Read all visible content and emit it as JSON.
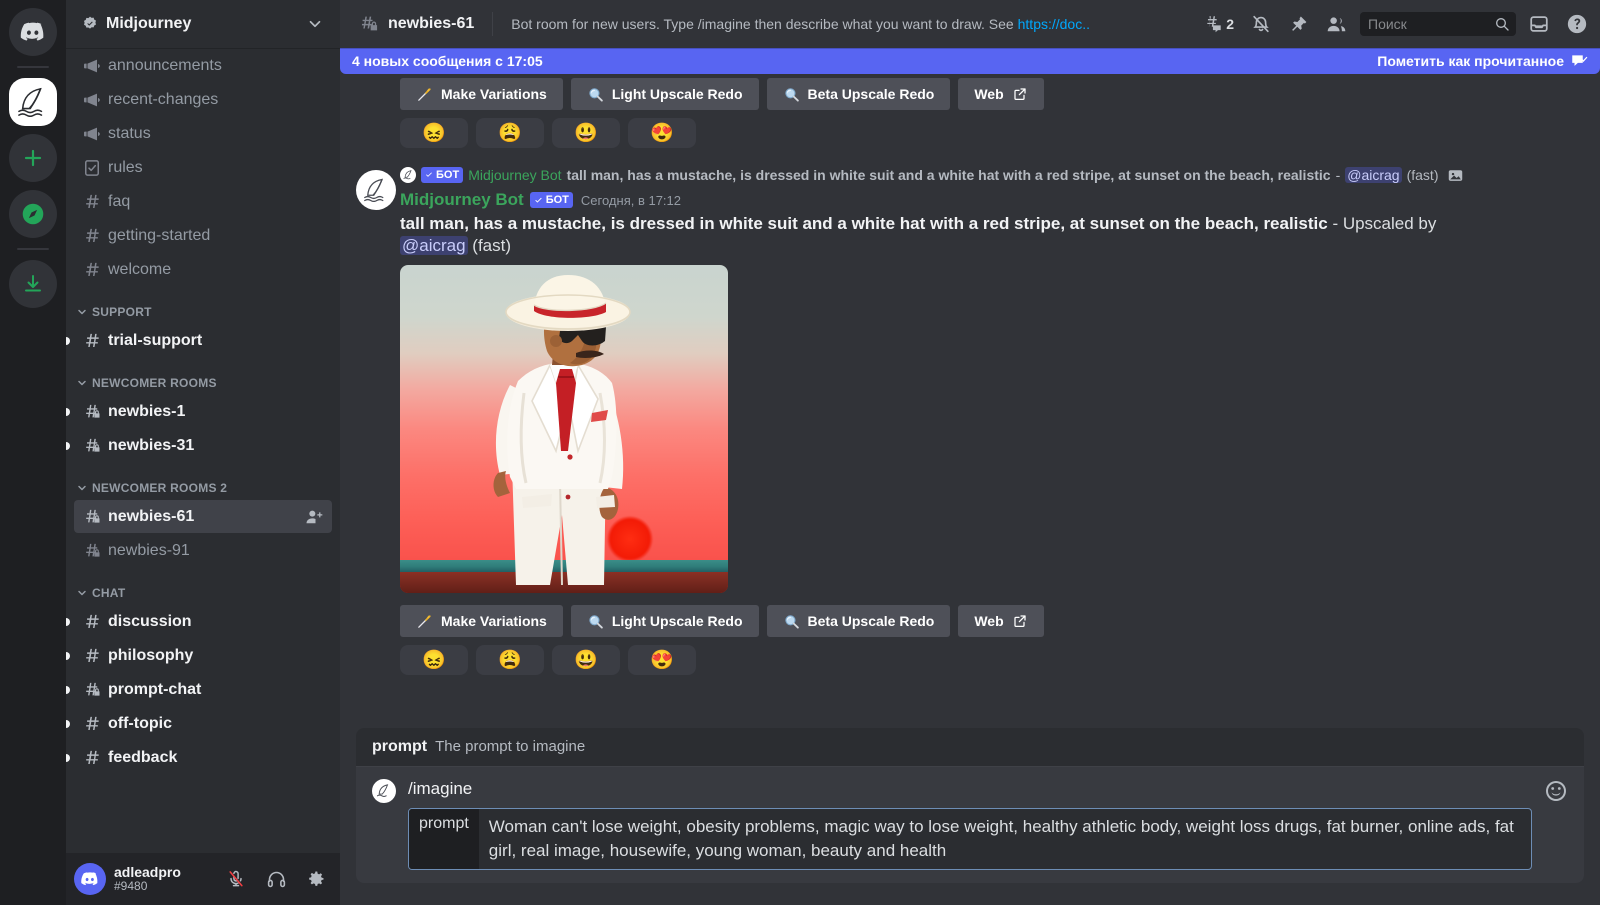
{
  "rail": {
    "items": [
      {
        "name": "discord-home",
        "icon": "discord-logo",
        "active": false
      },
      {
        "name": "server-midjourney",
        "icon": "midjourney-sail",
        "active": true
      },
      {
        "name": "add-server",
        "icon": "plus-icon",
        "active": false
      },
      {
        "name": "explore-servers",
        "icon": "compass-icon",
        "active": false
      },
      {
        "name": "download-apps",
        "icon": "download-icon",
        "active": false
      }
    ]
  },
  "sidebar": {
    "guild_name": "Midjourney",
    "groups": [
      {
        "label": "",
        "channels": [
          {
            "name": "announcements",
            "icon": "announcement-icon",
            "state": "muted",
            "unread": false
          },
          {
            "name": "recent-changes",
            "icon": "announcement-icon",
            "state": "muted",
            "unread": false
          },
          {
            "name": "status",
            "icon": "announcement-icon",
            "state": "muted",
            "unread": false
          },
          {
            "name": "rules",
            "icon": "rules-icon",
            "state": "muted",
            "unread": false
          },
          {
            "name": "faq",
            "icon": "hash-icon",
            "state": "muted",
            "unread": false
          },
          {
            "name": "getting-started",
            "icon": "hash-icon",
            "state": "muted",
            "unread": false
          },
          {
            "name": "welcome",
            "icon": "hash-icon",
            "state": "muted",
            "unread": false
          }
        ]
      },
      {
        "label": "SUPPORT",
        "channels": [
          {
            "name": "trial-support",
            "icon": "hash-icon",
            "state": "unread",
            "unread": true
          }
        ]
      },
      {
        "label": "NEWCOMER ROOMS",
        "channels": [
          {
            "name": "newbies-1",
            "icon": "hash-locked-icon",
            "state": "unread",
            "unread": true
          },
          {
            "name": "newbies-31",
            "icon": "hash-locked-icon",
            "state": "unread",
            "unread": true
          }
        ]
      },
      {
        "label": "NEWCOMER ROOMS 2",
        "channels": [
          {
            "name": "newbies-61",
            "icon": "hash-locked-icon",
            "state": "selected",
            "unread": false,
            "action_icon": "add-member-icon"
          },
          {
            "name": "newbies-91",
            "icon": "hash-locked-icon",
            "state": "muted",
            "unread": false
          }
        ]
      },
      {
        "label": "CHAT",
        "channels": [
          {
            "name": "discussion",
            "icon": "hash-icon",
            "state": "unread",
            "unread": true
          },
          {
            "name": "philosophy",
            "icon": "hash-icon",
            "state": "unread",
            "unread": true
          },
          {
            "name": "prompt-chat",
            "icon": "hash-locked-icon",
            "state": "unread",
            "unread": true
          },
          {
            "name": "off-topic",
            "icon": "hash-icon",
            "state": "unread",
            "unread": true
          },
          {
            "name": "feedback",
            "icon": "hash-icon",
            "state": "unread",
            "unread": true
          }
        ]
      }
    ],
    "user": {
      "name": "adleadpro",
      "tag": "#9480",
      "buttons": [
        "mute-icon",
        "deafen-icon",
        "settings-icon"
      ]
    }
  },
  "topbar": {
    "channel_name": "newbies-61",
    "topic_text": "Bot room for new users. Type /imagine then describe what you want to draw. See ",
    "topic_link": "https://doc..",
    "threads_count": "2",
    "icons": [
      "threads-icon",
      "notifications-off-icon",
      "pinned-messages-icon",
      "member-list-icon",
      "inbox-icon",
      "help-icon"
    ],
    "search_placeholder": "Поиск"
  },
  "unread_banner": {
    "text": "4 новых сообщения с 17:05",
    "mark_read_label": "Пометить как прочитанное",
    "color": "#5865f2"
  },
  "top_message_actions": {
    "buttons": [
      {
        "label": "Make Variations",
        "icon": "sparkle-wand-icon"
      },
      {
        "label": "Light Upscale Redo",
        "icon": "magnifier-icon"
      },
      {
        "label": "Beta Upscale Redo",
        "icon": "magnifier-icon"
      },
      {
        "label": "Web",
        "icon": "external-link-icon"
      }
    ],
    "reactions": [
      "😖",
      "😩",
      "😃",
      "😍"
    ]
  },
  "message": {
    "reply_reference": {
      "bot_tag": "БОТ",
      "author": "Midjourney Bot",
      "prompt_bold": "tall man, has a mustache, is dressed in white suit and a white hat with a red stripe, at sunset on the beach, realistic",
      "dash": " - ",
      "mention": "@aicrag",
      "speed": "(fast)",
      "attachment_icon": "image-attachment-icon"
    },
    "author": "Midjourney Bot",
    "bot_tag": "БОТ",
    "timestamp": "Сегодня, в 17:12",
    "prompt_bold": "tall man, has a mustache, is dressed in white suit and a white hat with a red stripe, at sunset on the beach, realistic",
    "suffix_before_mention": " - Upscaled by ",
    "mention": "@aicrag",
    "speed": "(fast)",
    "image_alt": "Man in white suit with white hat and red stripe at sunset on the beach",
    "buttons": [
      {
        "label": "Make Variations",
        "icon": "sparkle-wand-icon"
      },
      {
        "label": "Light Upscale Redo",
        "icon": "magnifier-icon"
      },
      {
        "label": "Beta Upscale Redo",
        "icon": "magnifier-icon"
      },
      {
        "label": "Web",
        "icon": "external-link-icon"
      }
    ],
    "reactions": [
      "😖",
      "😩",
      "😃",
      "😍"
    ]
  },
  "composer": {
    "hint_key": "prompt",
    "hint_desc": "The prompt to imagine",
    "command": "/imagine",
    "slot_label": "prompt",
    "slot_value": "Woman can't lose weight, obesity problems, magic way to lose weight, healthy athletic body, weight loss drugs, fat burner, online ads, fat girl, real image, housewife, young woman, beauty and health",
    "emoji_button": "emoji-picker-icon"
  }
}
